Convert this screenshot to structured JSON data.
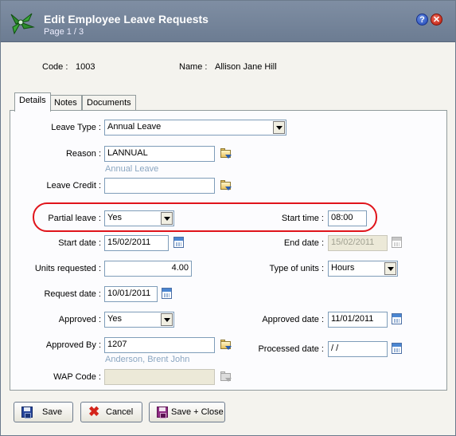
{
  "window": {
    "title": "Edit Employee Leave Requests",
    "subtitle": "Page 1 / 3",
    "help_label": "?",
    "close_label": "✕"
  },
  "header": {
    "code_label": "Code :",
    "code_value": "1003",
    "name_label": "Name :",
    "name_value": "Allison Jane Hill"
  },
  "tabs": [
    {
      "label": "Details",
      "active": true
    },
    {
      "label": "Notes",
      "active": false
    },
    {
      "label": "Documents",
      "active": false
    }
  ],
  "form": {
    "leave_type": {
      "label": "Leave Type :",
      "value": "Annual Leave"
    },
    "reason": {
      "label": "Reason :",
      "value": "LANNUAL",
      "hint": "Annual Leave"
    },
    "leave_credit": {
      "label": "Leave Credit :",
      "value": ""
    },
    "partial_leave": {
      "label": "Partial leave :",
      "value": "Yes"
    },
    "start_time": {
      "label": "Start time :",
      "value": "08:00"
    },
    "start_date": {
      "label": "Start date :",
      "value": "15/02/2011"
    },
    "end_date": {
      "label": "End date :",
      "value": "15/02/2011"
    },
    "units_requested": {
      "label": "Units requested :",
      "value": "4.00"
    },
    "type_of_units": {
      "label": "Type of units :",
      "value": "Hours"
    },
    "request_date": {
      "label": "Request date :",
      "value": "10/01/2011"
    },
    "approved": {
      "label": "Approved :",
      "value": "Yes"
    },
    "approved_date": {
      "label": "Approved date :",
      "value": "11/01/2011"
    },
    "approved_by": {
      "label": "Approved By :",
      "value": "1207",
      "hint": "Anderson, Brent John"
    },
    "processed_date": {
      "label": "Processed date :",
      "value": " /  /"
    },
    "wap_code": {
      "label": "WAP Code :",
      "value": ""
    }
  },
  "buttons": {
    "save": "Save",
    "cancel": "Cancel",
    "save_close": "Save + Close"
  },
  "colors": {
    "highlight_ring": "#e0141b",
    "titlebar": "#7685a0",
    "hint_text": "#8aa6c1"
  }
}
